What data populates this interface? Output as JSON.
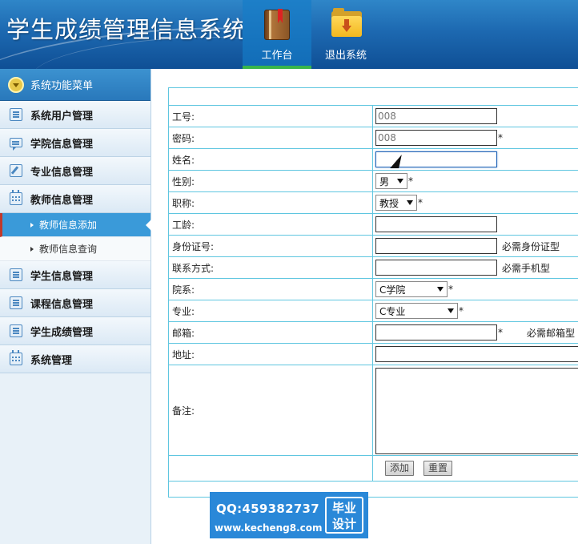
{
  "app": {
    "title": "学生成绩管理信息系统"
  },
  "topnav": [
    {
      "label": "工作台",
      "icon": "book-icon",
      "active": true
    },
    {
      "label": "退出系统",
      "icon": "exit-folder-icon",
      "active": false
    }
  ],
  "sidebar": {
    "header": "系统功能菜单",
    "items": [
      {
        "label": "系统用户管理",
        "icon": "list-icon"
      },
      {
        "label": "学院信息管理",
        "icon": "chat-icon"
      },
      {
        "label": "专业信息管理",
        "icon": "edit-icon"
      },
      {
        "label": "教师信息管理",
        "icon": "calendar-icon",
        "children": [
          {
            "label": "教师信息添加",
            "active": true
          },
          {
            "label": "教师信息查询",
            "active": false
          }
        ]
      },
      {
        "label": "学生信息管理",
        "icon": "list-icon"
      },
      {
        "label": "课程信息管理",
        "icon": "list-icon"
      },
      {
        "label": "学生成绩管理",
        "icon": "list-icon"
      },
      {
        "label": "系统管理",
        "icon": "calendar-icon"
      }
    ]
  },
  "form": {
    "labels": {
      "id": "工号:",
      "password": "密码:",
      "name": "姓名:",
      "gender": "性别:",
      "title": "职称:",
      "seniority": "工龄:",
      "id_card": "身份证号:",
      "contact": "联系方式:",
      "dept": "院系:",
      "major": "专业:",
      "email": "邮箱:",
      "address": "地址:",
      "remark": "备注:"
    },
    "values": {
      "id": "008",
      "password": "008",
      "name": "",
      "gender": "男",
      "title": "教授",
      "seniority": "",
      "id_card": "",
      "contact": "",
      "dept": "C学院",
      "major": "C专业",
      "email": "",
      "address": "",
      "remark": ""
    },
    "required_mark": "*",
    "hints": {
      "id_card": "必需身份证型",
      "contact": "必需手机型",
      "email": "必需邮箱型"
    },
    "buttons": {
      "add": "添加",
      "reset": "重置"
    }
  },
  "watermark": {
    "qq": "QQ:459382737",
    "site": "www.kecheng8.com",
    "badge_line1": "毕业",
    "badge_line2": "设计"
  }
}
